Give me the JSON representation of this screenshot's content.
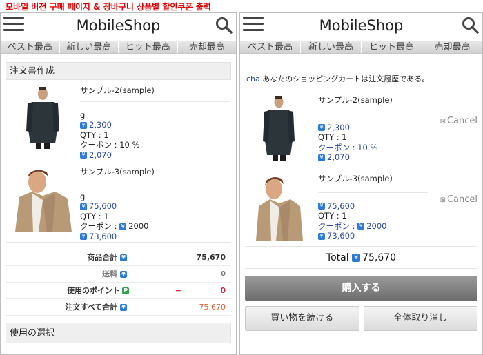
{
  "caption": "모바일 버전 구매 페이지 & 장바구니 상품별 할인쿠폰 출력",
  "app": {
    "title": "MobileShop"
  },
  "tabs": [
    "ベスト最高",
    "新しい最高",
    "ヒット最高",
    "売却最高"
  ],
  "left": {
    "section_title": "注文書作成",
    "items": [
      {
        "name": "サンプル-2(sample)",
        "unit": "g",
        "price": "2,300",
        "qty": "QTY : 1",
        "coupon": "クーポン : 10 %",
        "final": "2,070"
      },
      {
        "name": "サンプル-3(sample)",
        "unit": "g",
        "price": "75,600",
        "qty": "QTY : 1",
        "coupon_label": "クーポン : ",
        "coupon_value": "2000",
        "final": "73,600"
      }
    ],
    "totals": {
      "subtotal_label": "商品合計",
      "subtotal": "75,670",
      "shipping_label": "送料",
      "shipping": "0",
      "points_label": "使用のポイント",
      "points_minus": "−",
      "points": "0",
      "grand_label": "注文すべて合計",
      "grand": "75,670"
    },
    "select_title": "使用の選択"
  },
  "right": {
    "user": "cha",
    "cart_message": " あなたのショッピングカートは注文履歴である。",
    "items": [
      {
        "name": "サンプル-2(sample)",
        "price": "2,300",
        "qty": "QTY : 1",
        "coupon": "クーポン : 10 %",
        "final": "2,070",
        "cancel": "Cancel"
      },
      {
        "name": "サンプル-3(sample)",
        "price": "75,600",
        "qty": "QTY : 1",
        "coupon_label": "クーポン : ",
        "coupon_value": "2000",
        "final": "73,600",
        "cancel": "Cancel"
      }
    ],
    "total_label": "Total",
    "total": "75,670",
    "buy_label": "購入する",
    "continue_label": "買い物を続ける",
    "cancel_all_label": "全体取り消し"
  },
  "colors": {
    "price": "#2a4aa0",
    "caption": "#e00000",
    "grand": "#e0603a",
    "minus": "#d22233"
  }
}
